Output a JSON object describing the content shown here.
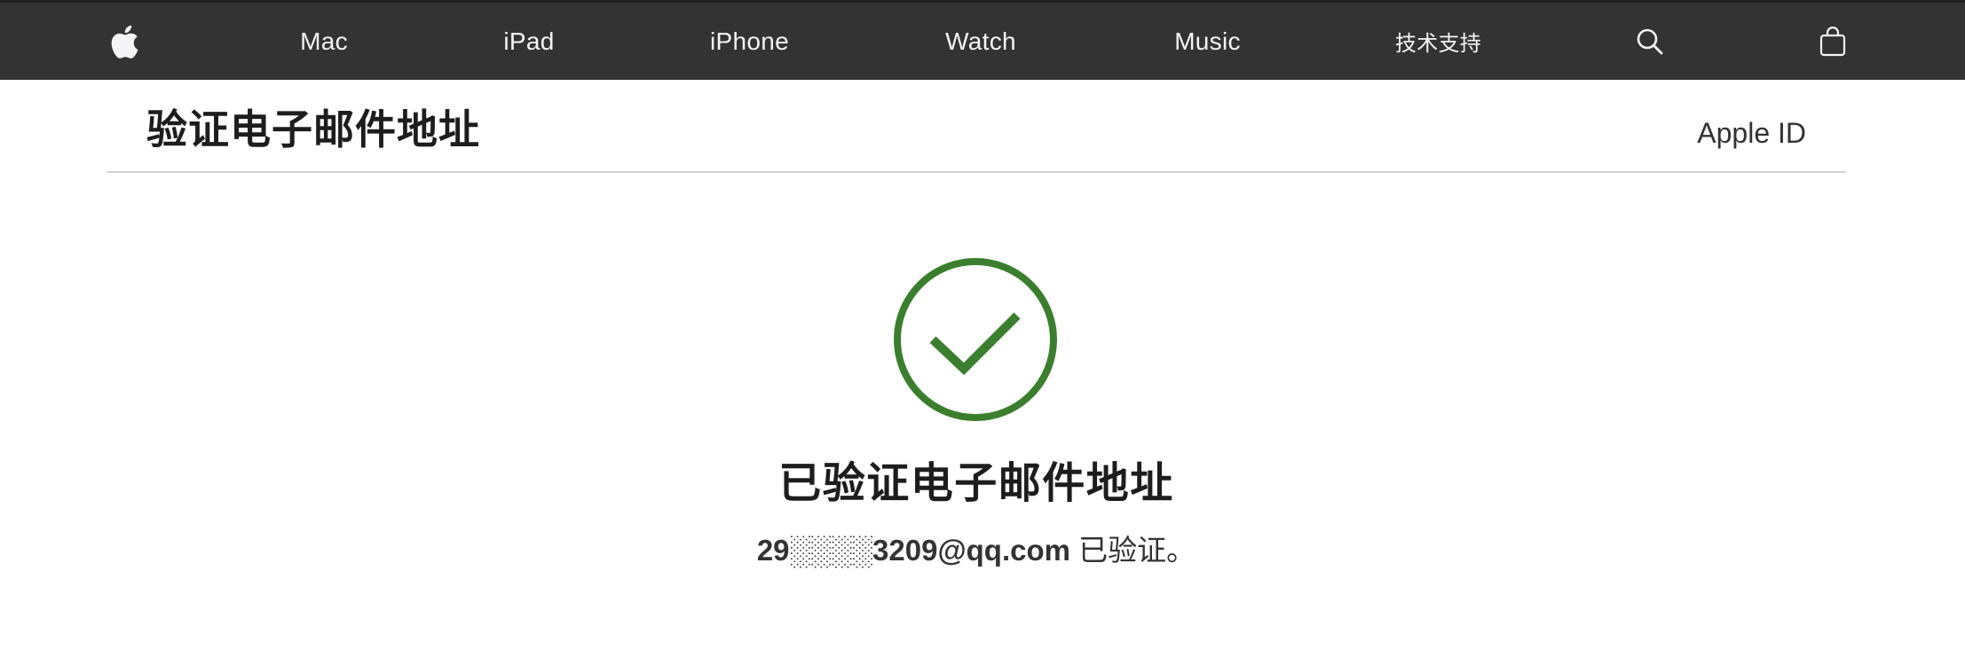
{
  "nav": {
    "items": [
      {
        "label": "Mac"
      },
      {
        "label": "iPad"
      },
      {
        "label": "iPhone"
      },
      {
        "label": "Watch"
      },
      {
        "label": "Music"
      },
      {
        "label": "技术支持"
      }
    ],
    "icons": {
      "logo": "apple-logo-icon",
      "search": "search-icon",
      "bag": "shopping-bag-icon"
    },
    "background_color": "#333333",
    "text_color": "#f5f5f7"
  },
  "header": {
    "title": "验证电子邮件地址",
    "apple_id_link": "Apple ID"
  },
  "main": {
    "status_icon": "check-circle-icon",
    "status_color": "#3b7f2e",
    "status_title": "已验证电子邮件地址",
    "email": "29░░░░3209@qq.com",
    "verified_suffix": "已验证。"
  }
}
